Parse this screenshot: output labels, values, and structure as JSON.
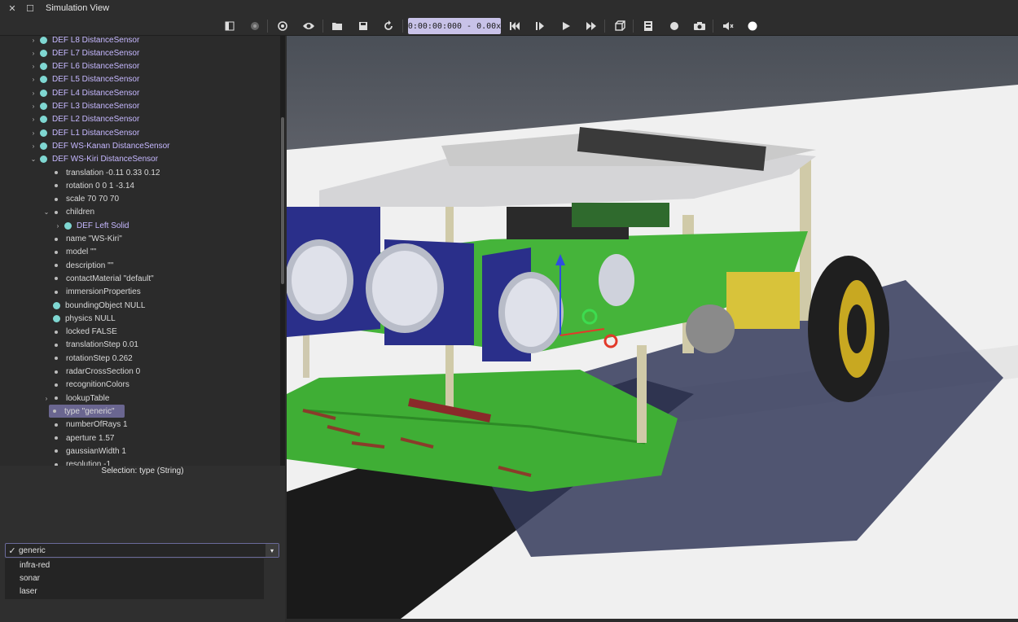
{
  "window": {
    "title": "Simulation View",
    "close_glyph": "✕",
    "maximize_glyph": "☐"
  },
  "toolbar": {
    "time": "0:00:00:000",
    "speed": "0.00x",
    "separator": "-",
    "icons": [
      "panel-toggle-icon",
      "dot-icon",
      "sync-icon",
      "eye-icon",
      "open-folder-icon",
      "save-icon",
      "reload-icon",
      "skip-back-icon",
      "step-icon",
      "play-icon",
      "fast-forward-icon",
      "view-cube-icon",
      "film-icon",
      "record-icon",
      "camera-icon",
      "mute-icon",
      "circle-icon"
    ]
  },
  "tree": {
    "rows": [
      {
        "label": "DEF L8 DistanceSensor",
        "kind": "def",
        "arrow": "›"
      },
      {
        "label": "DEF L7 DistanceSensor",
        "kind": "def",
        "arrow": "›"
      },
      {
        "label": "DEF L6 DistanceSensor",
        "kind": "def",
        "arrow": "›"
      },
      {
        "label": "DEF L5 DistanceSensor",
        "kind": "def",
        "arrow": "›"
      },
      {
        "label": "DEF L4 DistanceSensor",
        "kind": "def",
        "arrow": "›"
      },
      {
        "label": "DEF L3 DistanceSensor",
        "kind": "def",
        "arrow": "›"
      },
      {
        "label": "DEF L2 DistanceSensor",
        "kind": "def",
        "arrow": "›"
      },
      {
        "label": "DEF L1 DistanceSensor",
        "kind": "def",
        "arrow": "›"
      },
      {
        "label": "DEF WS-Kanan DistanceSensor",
        "kind": "def",
        "arrow": "›"
      },
      {
        "label": "DEF WS-Kiri DistanceSensor",
        "kind": "def",
        "arrow": "⌄"
      },
      {
        "label": "translation -0.11 0.33 0.12",
        "kind": "def-field"
      },
      {
        "label": "rotation 0 0 1 -3.14",
        "kind": "def-field"
      },
      {
        "label": "scale 70 70 70",
        "kind": "def-field"
      },
      {
        "label": "children",
        "kind": "def-field",
        "arrow": "⌄"
      },
      {
        "label": "DEF Left Solid",
        "kind": "def-child",
        "arrow": "›"
      },
      {
        "label": "name \"WS-Kiri\"",
        "kind": "field"
      },
      {
        "label": "model \"\"",
        "kind": "field"
      },
      {
        "label": "description \"\"",
        "kind": "field"
      },
      {
        "label": "contactMaterial \"default\"",
        "kind": "field"
      },
      {
        "label": "immersionProperties",
        "kind": "field"
      },
      {
        "label": "boundingObject NULL",
        "kind": "node-field"
      },
      {
        "label": "physics NULL",
        "kind": "node-field"
      },
      {
        "label": "locked FALSE",
        "kind": "field"
      },
      {
        "label": "translationStep 0.01",
        "kind": "field"
      },
      {
        "label": "rotationStep 0.262",
        "kind": "field"
      },
      {
        "label": "radarCrossSection 0",
        "kind": "field"
      },
      {
        "label": "recognitionColors",
        "kind": "field"
      },
      {
        "label": "lookupTable",
        "kind": "field",
        "arrow": "›"
      },
      {
        "label": "type \"generic\"",
        "kind": "field",
        "selected": true
      },
      {
        "label": "numberOfRays 1",
        "kind": "field"
      },
      {
        "label": "aperture 1.57",
        "kind": "field"
      },
      {
        "label": "gaussianWidth 1",
        "kind": "field"
      },
      {
        "label": "resolution -1",
        "kind": "field"
      }
    ]
  },
  "selection": {
    "label": "Selection: type (String)"
  },
  "type_select": {
    "value": "generic",
    "check": "✓",
    "options": [
      "infra-red",
      "sonar",
      "laser"
    ]
  },
  "colors": {
    "accent": "#6a6690",
    "def_text": "#c6b8ff",
    "node_dot": "#7fd7d2",
    "time_bg": "#c8c2e8"
  }
}
